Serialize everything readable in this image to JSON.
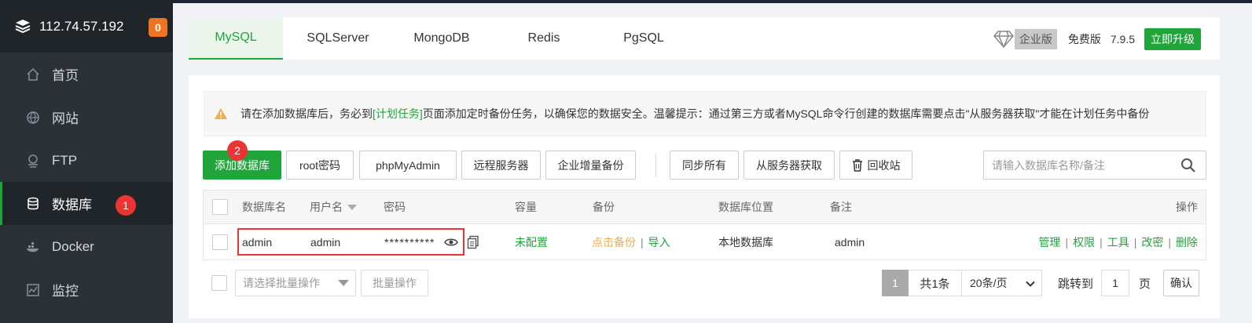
{
  "server": {
    "ip": "112.74.57.192",
    "badge": "0"
  },
  "sidebar": {
    "items": [
      {
        "label": "首页",
        "icon": "home-icon"
      },
      {
        "label": "网站",
        "icon": "globe-icon"
      },
      {
        "label": "FTP",
        "icon": "ftp-icon"
      },
      {
        "label": "数据库",
        "icon": "database-icon",
        "active": true,
        "step": "1"
      },
      {
        "label": "Docker",
        "icon": "docker-icon"
      },
      {
        "label": "监控",
        "icon": "monitor-icon"
      }
    ]
  },
  "tabs": [
    "MySQL",
    "SQLServer",
    "MongoDB",
    "Redis",
    "PgSQL"
  ],
  "topright": {
    "enterprise": "企业版",
    "free": "免费版",
    "version": "7.9.5",
    "upgrade": "立即升级"
  },
  "notice": {
    "before": "请在添加数据库后，务必到",
    "link": "[计划任务]",
    "after": "页面添加定时备份任务，以确保您的数据安全。温馨提示：通过第三方或者MySQL命令行创建的数据库需要点击\"从服务器获取\"才能在计划任务中备份"
  },
  "toolbar": {
    "add": "添加数据库",
    "step": "2",
    "root": "root密码",
    "pma": "phpMyAdmin",
    "remote": "远程服务器",
    "enterprise_backup": "企业增量备份",
    "sync_all": "同步所有",
    "fetch": "从服务器获取",
    "recycle": "回收站",
    "search_placeholder": "请输入数据库名称/备注"
  },
  "table": {
    "headers": {
      "name": "数据库名",
      "user": "用户名",
      "password": "密码",
      "capacity": "容量",
      "backup": "备份",
      "location": "数据库位置",
      "note": "备注",
      "ops": "操作"
    },
    "rows": [
      {
        "name": "admin",
        "user": "admin",
        "password": "**********",
        "capacity": "未配置",
        "backup": "点击备份",
        "import": "导入",
        "location": "本地数据库",
        "note": "admin",
        "ops": [
          "管理",
          "权限",
          "工具",
          "改密",
          "删除"
        ]
      }
    ]
  },
  "footer": {
    "batch_placeholder": "请选择批量操作",
    "batch_button": "批量操作",
    "page": "1",
    "total": "共1条",
    "page_size": "20条/页",
    "jump_label": "跳转到",
    "jump_value": "1",
    "page_unit": "页",
    "confirm": "确认"
  },
  "colors": {
    "accent": "#20a53a",
    "sidebar": "#2b3137",
    "alert": "#ee3333",
    "warning": "#f0ad4e"
  }
}
